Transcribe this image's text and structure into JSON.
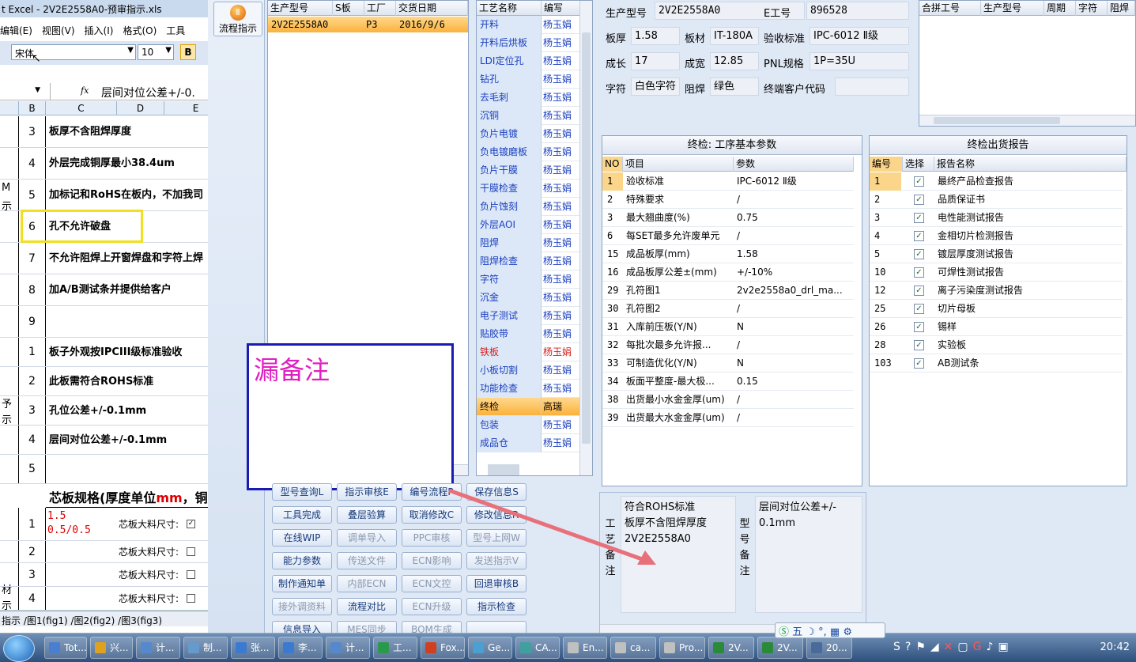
{
  "excel": {
    "title": "t Excel - 2V2E2558A0-预审指示.xls",
    "menu": [
      "编辑(E)",
      "视图(V)",
      "插入(I)",
      "格式(O)",
      "工具"
    ],
    "font_name": "宋体",
    "font_size": "10",
    "bold": "B",
    "formula_label": "fx",
    "formula_text": "层间对位公差+/-0.",
    "columns": [
      "B",
      "C",
      "D",
      "E"
    ],
    "rows": [
      {
        "num": "3",
        "text": "板厚不含阻焊厚度"
      },
      {
        "num": "4",
        "text": "外层完成铜厚最小38.4um"
      },
      {
        "num": "5",
        "text": "加标记和RoHS在板内，不加我司"
      },
      {
        "num": "6",
        "text": "孔不允许破盘"
      },
      {
        "num": "7",
        "text": "不允许阻焊上开窗焊盘和字符上焊"
      },
      {
        "num": "8",
        "text": "加A/B测试条并提供给客户"
      },
      {
        "num": "9",
        "text": ""
      },
      {
        "num": "1",
        "text": "板子外观按IPCIII级标准验收"
      },
      {
        "num": "2",
        "text": "此板需符合ROHS标准"
      },
      {
        "num": "3",
        "text": "孔位公差+/-0.1mm"
      },
      {
        "num": "4",
        "text": "层间对位公差+/-0.1mm"
      },
      {
        "num": "5",
        "text": ""
      }
    ],
    "side_labels": [
      "M",
      "示",
      "予",
      "示",
      "材",
      "示"
    ],
    "core_title": "芯板规格(厚度单位",
    "core_unit": "mm",
    "core_title2": "，铜厚",
    "core_rows": [
      {
        "num": "1",
        "spec": "1.5\n0.5/0.5",
        "label": "芯板大料尺寸:"
      },
      {
        "num": "2",
        "spec": "",
        "label": "芯板大料尺寸:"
      },
      {
        "num": "3",
        "spec": "",
        "label": "芯板大料尺寸:"
      },
      {
        "num": "4",
        "spec": "",
        "label": "芯板大料尺寸:"
      }
    ],
    "sheet_tabs": "指示 /图1(fig1) /图2(fig2) /图3(fig3)"
  },
  "toolbar": {
    "flow_label": "流程指示"
  },
  "order_grid": {
    "headers": [
      "生产型号",
      "S板",
      "工厂",
      "交货日期"
    ],
    "row": {
      "model": "2V2E2558A0",
      "s": "",
      "factory": "P3",
      "date": "2016/9/6"
    }
  },
  "process_grid": {
    "headers": [
      "工艺名称",
      "编写"
    ],
    "rows": [
      {
        "name": "开料",
        "author": "杨玉娟"
      },
      {
        "name": "开料后烘板",
        "author": "杨玉娟"
      },
      {
        "name": "LDI定位孔",
        "author": "杨玉娟"
      },
      {
        "name": "钻孔",
        "author": "杨玉娟"
      },
      {
        "name": "去毛刺",
        "author": "杨玉娟"
      },
      {
        "name": "沉铜",
        "author": "杨玉娟"
      },
      {
        "name": "负片电镀",
        "author": "杨玉娟"
      },
      {
        "name": "负电镀磨板",
        "author": "杨玉娟"
      },
      {
        "name": "负片干膜",
        "author": "杨玉娟"
      },
      {
        "name": "干膜检查",
        "author": "杨玉娟"
      },
      {
        "name": "负片蚀刻",
        "author": "杨玉娟"
      },
      {
        "name": "外层AOI",
        "author": "杨玉娟"
      },
      {
        "name": "阻焊",
        "author": "杨玉娟"
      },
      {
        "name": "阻焊检查",
        "author": "杨玉娟"
      },
      {
        "name": "字符",
        "author": "杨玉娟"
      },
      {
        "name": "沉金",
        "author": "杨玉娟"
      },
      {
        "name": "电子测试",
        "author": "杨玉娟"
      },
      {
        "name": "贴胶带",
        "author": "杨玉娟"
      },
      {
        "name": "铁板",
        "author": "杨玉娟",
        "red": true
      },
      {
        "name": "小板切割",
        "author": "杨玉娟"
      },
      {
        "name": "功能检查",
        "author": "杨玉娟"
      },
      {
        "name": "终检",
        "author": "高瑞",
        "selected": true
      },
      {
        "name": "包装",
        "author": "杨玉娟"
      },
      {
        "name": "成品仓",
        "author": "杨玉娟"
      }
    ]
  },
  "note": {
    "text": "漏备注"
  },
  "buttons": [
    {
      "label": "型号查询L",
      "dis": false
    },
    {
      "label": "指示审核E",
      "dis": false
    },
    {
      "label": "编号流程P",
      "dis": false
    },
    {
      "label": "保存信息S",
      "dis": false
    },
    {
      "label": "工具完成",
      "dis": false
    },
    {
      "label": "叠层验算",
      "dis": false
    },
    {
      "label": "取消修改C",
      "dis": false
    },
    {
      "label": "修改信息R",
      "dis": false
    },
    {
      "label": "在线WIP",
      "dis": false
    },
    {
      "label": "调单导入",
      "dis": true
    },
    {
      "label": "PPC审核",
      "dis": true
    },
    {
      "label": "型号上网W",
      "dis": true
    },
    {
      "label": "能力参数",
      "dis": false
    },
    {
      "label": "传送文件",
      "dis": true
    },
    {
      "label": "ECN影响",
      "dis": true
    },
    {
      "label": "发送指示V",
      "dis": true
    },
    {
      "label": "制作通知单",
      "dis": false
    },
    {
      "label": "内部ECN",
      "dis": true
    },
    {
      "label": "ECN文控",
      "dis": true
    },
    {
      "label": "回退审核B",
      "dis": false
    },
    {
      "label": "接外调资料",
      "dis": true
    },
    {
      "label": "流程对比",
      "dis": false
    },
    {
      "label": "ECN升级",
      "dis": true
    },
    {
      "label": "指示检查",
      "dis": false
    },
    {
      "label": "信息导入",
      "dis": false
    },
    {
      "label": "MES同步",
      "dis": true
    },
    {
      "label": "BOM生成",
      "dis": true
    },
    {
      "label": "",
      "dis": false
    }
  ],
  "info": {
    "model_label": "生产型号",
    "model": "2V2E2558A0",
    "eno_label": "E工号",
    "eno": "896528",
    "thick_label": "板厚",
    "thick": "1.58",
    "mat_label": "板材",
    "mat": "IT-180A",
    "std_label": "验收标准",
    "std": "IPC-6012 Ⅱ级",
    "grow_label": "成长",
    "grow": "17",
    "finish_label": "成宽",
    "finish": "12.85",
    "pnl_label": "PNL规格",
    "pnl": "1P=35U",
    "char_label": "字符",
    "char": "白色字符",
    "mask_label": "阻焊",
    "mask": "绿色",
    "cust_label": "终端客户代码",
    "cust": ""
  },
  "merge_grid": {
    "headers": [
      "合拼工号",
      "生产型号",
      "周期",
      "字符",
      "阻焊"
    ]
  },
  "params": {
    "title": "终检: 工序基本参数",
    "headers": [
      "NO",
      "项目",
      "参数"
    ],
    "rows": [
      {
        "no": "1",
        "item": "验收标准",
        "val": "IPC-6012 Ⅱ级"
      },
      {
        "no": "2",
        "item": "特殊要求",
        "val": "/"
      },
      {
        "no": "3",
        "item": "最大翘曲度(%)",
        "val": "0.75"
      },
      {
        "no": "6",
        "item": "每SET最多允许废单元",
        "val": "/"
      },
      {
        "no": "15",
        "item": "成品板厚(mm)",
        "val": "1.58"
      },
      {
        "no": "16",
        "item": "成品板厚公差±(mm)",
        "val": "+/-10%"
      },
      {
        "no": "29",
        "item": "孔符图1",
        "val": "2v2e2558a0_drl_ma..."
      },
      {
        "no": "30",
        "item": "孔符图2",
        "val": "/"
      },
      {
        "no": "31",
        "item": "入库前压板(Y/N)",
        "val": "N"
      },
      {
        "no": "32",
        "item": "每批次最多允许报...",
        "val": "/"
      },
      {
        "no": "33",
        "item": "可制造优化(Y/N)",
        "val": "N"
      },
      {
        "no": "34",
        "item": "板面平整度-最大极...",
        "val": "0.15"
      },
      {
        "no": "38",
        "item": "出货最小水金金厚(um)",
        "val": "/"
      },
      {
        "no": "39",
        "item": "出货最大水金金厚(um)",
        "val": "/"
      }
    ]
  },
  "reports": {
    "title": "终检出货报告",
    "headers": [
      "编号",
      "选择",
      "报告名称"
    ],
    "rows": [
      {
        "no": "1",
        "name": "最终产品检查报告"
      },
      {
        "no": "2",
        "name": "品质保证书"
      },
      {
        "no": "3",
        "name": "电性能测试报告"
      },
      {
        "no": "4",
        "name": "金相切片检测报告"
      },
      {
        "no": "5",
        "name": "镀层厚度测试报告"
      },
      {
        "no": "10",
        "name": "可焊性测试报告"
      },
      {
        "no": "12",
        "name": "离子污染度测试报告"
      },
      {
        "no": "25",
        "name": "切片母板"
      },
      {
        "no": "26",
        "name": "锡样"
      },
      {
        "no": "28",
        "name": "实验板"
      },
      {
        "no": "103",
        "name": "AB测试条"
      }
    ]
  },
  "remarks": {
    "proc_label": "工艺备注",
    "proc_text": "符合ROHS标准\n板厚不含阻焊厚度\n2V2E2558A0",
    "model_label": "型号备注",
    "model_text": "层间对位公差+/-\n0.1mm"
  },
  "taskbar": {
    "items": [
      "Tot...",
      "兴...",
      "计...",
      "制...",
      "张...",
      "李...",
      "计...",
      "工...",
      "Fox...",
      "Ge...",
      "CA...",
      "En...",
      "ca...",
      "Pro...",
      "2V...",
      "2V...",
      "20..."
    ],
    "ime": "五",
    "clock": "20:42"
  }
}
